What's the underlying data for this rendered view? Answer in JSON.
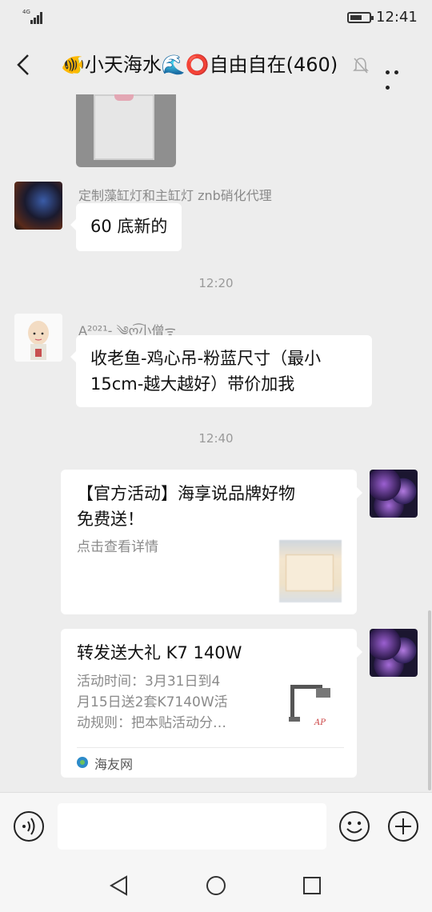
{
  "status_bar": {
    "network": "4G",
    "time": "12:41"
  },
  "header": {
    "title": "🐠小天海水🌊⭕自由自在(460)",
    "back_icon": "chevron-left-icon",
    "mute_icon": "bell-muted-icon",
    "more_icon": "more-dots-icon"
  },
  "messages": [
    {
      "type": "text",
      "side": "left",
      "sender": "定制藻缸灯和主缸灯 znb硝化代理",
      "text": "60 底新的"
    },
    {
      "type": "time",
      "text": "12:20"
    },
    {
      "type": "text",
      "side": "left",
      "sender": "A²⁰²¹- ༄ღ͜͡小僧ᯤ",
      "text_lines": [
        "收老鱼-鸡心吊-粉蓝尺寸（最小",
        "15cm-越大越好）带价加我"
      ]
    },
    {
      "type": "time",
      "text": "12:40"
    },
    {
      "type": "card",
      "side": "right",
      "title_lines": [
        "【官方活动】海享说品牌好物",
        "免费送！"
      ],
      "desc": "点击查看详情"
    },
    {
      "type": "card",
      "side": "right",
      "title": "转发送大礼 K7 140W",
      "desc_lines": [
        "活动时间：3月31日到4",
        "月15日送2套K7140W活",
        "动规则：把本贴活动分…"
      ],
      "thumb_brand": "AP",
      "source": "海友网"
    }
  ],
  "input_bar": {
    "voice_icon": "voice-icon",
    "text_value": "",
    "emoji_icon": "emoji-icon",
    "plus_icon": "plus-icon"
  },
  "nav_bar": {
    "back": "nav-back-icon",
    "home": "nav-home-icon",
    "recent": "nav-recent-icon"
  },
  "colors": {
    "background": "#ededed",
    "bubble": "#ffffff",
    "secondary_text": "#8a8a8a"
  }
}
